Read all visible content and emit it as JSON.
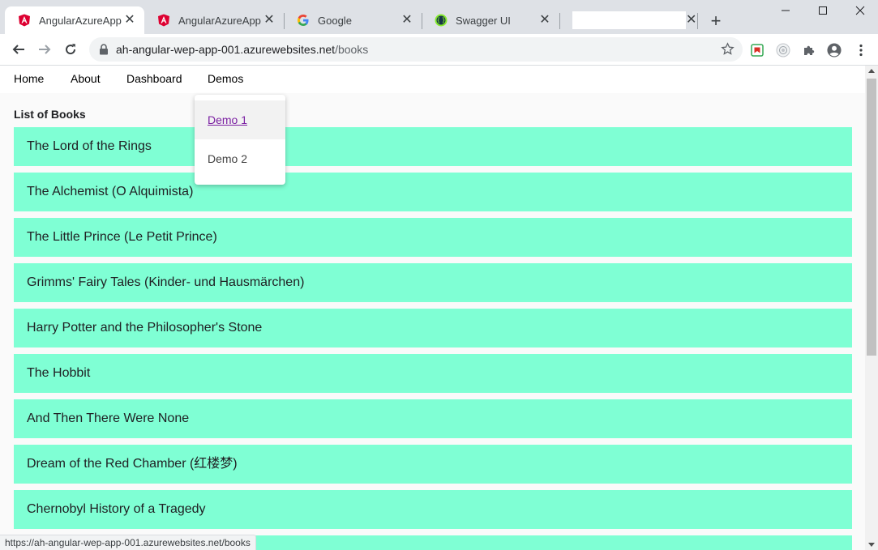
{
  "browser": {
    "tabs": [
      {
        "title": "AngularAzureApp",
        "icon": "angular-icon",
        "active": true
      },
      {
        "title": "AngularAzureApp",
        "icon": "angular-icon",
        "active": false
      },
      {
        "title": "Google",
        "icon": "google-icon",
        "active": false
      },
      {
        "title": "Swagger UI",
        "icon": "swagger-icon",
        "active": false
      },
      {
        "title": "",
        "icon": "blank-icon",
        "active": false
      }
    ],
    "url": {
      "host": "ah-angular-wep-app-001.azurewebsites.net",
      "path": "/books"
    },
    "status_url": "https://ah-angular-wep-app-001.azurewebsites.net/books",
    "colors": {
      "tabstrip": "#dee1e6",
      "angular": "#dd0031",
      "swagger": "#85ea2d"
    }
  },
  "app": {
    "nav": {
      "home": "Home",
      "about": "About",
      "dashboard": "Dashboard",
      "demos": "Demos"
    },
    "demos_menu": [
      "Demo 1",
      "Demo 2"
    ],
    "list_title": "List of Books",
    "books": [
      "The Lord of the Rings",
      "The Alchemist (O Alquimista)",
      "The Little Prince (Le Petit Prince)",
      "Grimms' Fairy Tales (Kinder- und Hausmärchen)",
      "Harry Potter and the Philosopher's Stone",
      "The Hobbit",
      "And Then There Were None",
      "Dream of the Red Chamber (红楼梦)",
      "Chernobyl History of a Tragedy"
    ],
    "colors": {
      "book_bg": "#7fffd4",
      "link_hover": "#7b1fa2"
    }
  }
}
